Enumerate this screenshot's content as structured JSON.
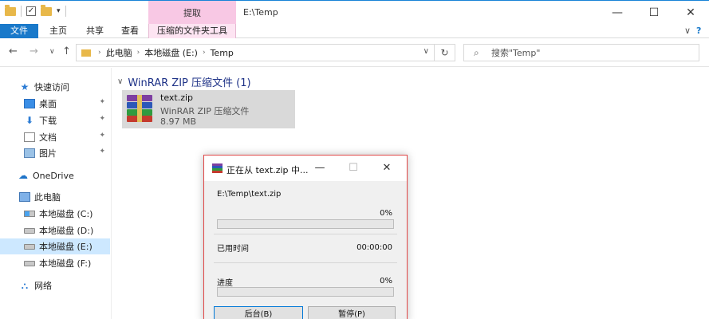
{
  "window": {
    "title": "E:\\Temp",
    "context_tab_header": "提取",
    "controls": {
      "minimize": "—",
      "maximize": "☐",
      "close": "✕"
    }
  },
  "ribbon": {
    "tabs": [
      "文件",
      "主页",
      "共享",
      "查看"
    ],
    "context_tab": "压缩的文件夹工具",
    "collapse_glyph": "∨",
    "help_glyph": "?"
  },
  "address": {
    "back": "←",
    "forward": "→",
    "recent": "∨",
    "up": "↑",
    "crumbs": [
      "此电脑",
      "本地磁盘 (E:)",
      "Temp"
    ],
    "crumb_sep": "›",
    "dropdown": "∨",
    "refresh": "↻"
  },
  "search": {
    "placeholder": "搜索\"Temp\"",
    "icon": "⌕"
  },
  "navpane": {
    "items": [
      {
        "label": "快速访问",
        "icon": "star-icon",
        "selected": false,
        "pinned": false
      },
      {
        "label": "桌面",
        "icon": "desktop-icon",
        "selected": false,
        "pinned": true
      },
      {
        "label": "下载",
        "icon": "download-icon",
        "selected": false,
        "pinned": true
      },
      {
        "label": "文档",
        "icon": "document-icon",
        "selected": false,
        "pinned": true
      },
      {
        "label": "图片",
        "icon": "pictures-icon",
        "selected": false,
        "pinned": true
      },
      {
        "label": "OneDrive",
        "icon": "cloud-icon",
        "selected": false,
        "pinned": false
      },
      {
        "label": "此电脑",
        "icon": "computer-icon",
        "selected": false,
        "pinned": false
      },
      {
        "label": "本地磁盘 (C:)",
        "icon": "drive-icon",
        "selected": false,
        "pinned": false
      },
      {
        "label": "本地磁盘 (D:)",
        "icon": "drive-icon",
        "selected": false,
        "pinned": false
      },
      {
        "label": "本地磁盘 (E:)",
        "icon": "drive-icon",
        "selected": true,
        "pinned": false
      },
      {
        "label": "本地磁盘 (F:)",
        "icon": "drive-icon",
        "selected": false,
        "pinned": false
      },
      {
        "label": "网络",
        "icon": "network-icon",
        "selected": false,
        "pinned": false
      }
    ],
    "pin_glyph": "📌"
  },
  "content": {
    "group_header": "WinRAR ZIP 压缩文件 (1)",
    "group_chevron": "∨",
    "file": {
      "name": "text.zip",
      "type": "WinRAR ZIP 压缩文件",
      "size": "8.97 MB",
      "icon": "winrar-archive-icon"
    }
  },
  "dialog": {
    "title": "正在从 text.zip 中...",
    "controls": {
      "minimize": "—",
      "maximize": "☐",
      "close": "✕"
    },
    "path": "E:\\Temp\\text.zip",
    "file_progress": "0%",
    "file_progress_value": 0,
    "elapsed_label": "已用时间",
    "elapsed_value": "00:00:00",
    "progress_label": "进度",
    "progress_value_text": "0%",
    "progress_value": 0,
    "buttons": {
      "background": "后台(B)",
      "pause": "暂停(P)"
    }
  },
  "colors": {
    "accent": "#1979ca",
    "context_tab": "#f8c8e4",
    "selection": "#cde8ff",
    "dialog_border": "#e04848",
    "progress_fill": "#06b025"
  }
}
